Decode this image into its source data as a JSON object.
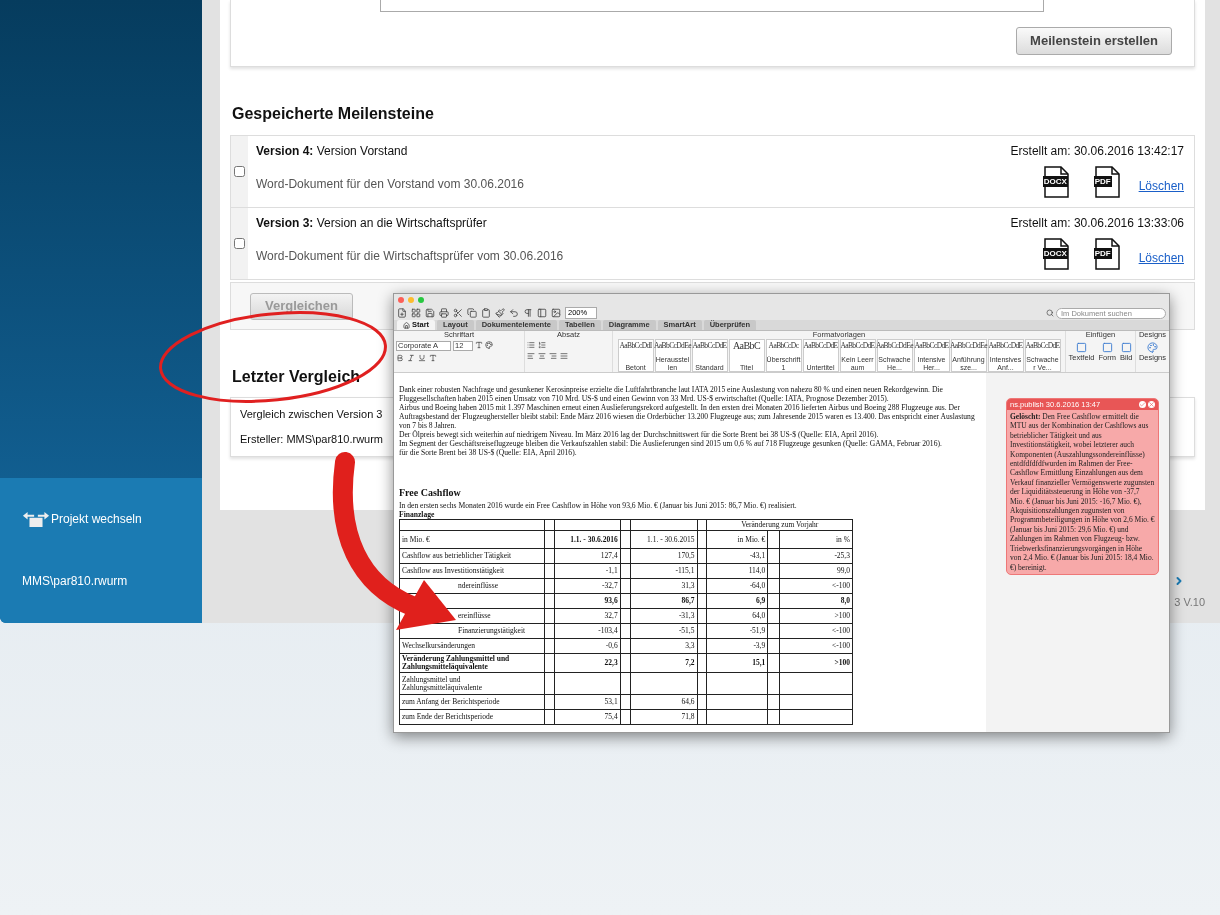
{
  "sidebar": {
    "switch_project": "Projekt wechseln",
    "user": "MMS\\par810.rwurm"
  },
  "milestone_form": {
    "create_button": "Meilenstein erstellen"
  },
  "saved_milestones": {
    "heading": "Gespeicherte Meilensteine",
    "items": [
      {
        "version": "Version 4:",
        "name": "Version Vorstand",
        "description": "Word-Dokument für den Vorstand vom 30.06.2016",
        "created": "Erstellt am: 30.06.2016 13:42:17",
        "checked": false,
        "docx": "DOCX",
        "pdf": "PDF",
        "delete": "Löschen"
      },
      {
        "version": "Version 3:",
        "name": "Version an die Wirtschaftsprüfer",
        "description": "Word-Dokument für die Wirtschaftsprüfer vom 30.06.2016",
        "created": "Erstellt am: 30.06.2016 13:33:06",
        "checked": false,
        "docx": "DOCX",
        "pdf": "PDF",
        "delete": "Löschen"
      }
    ],
    "compare_button": {
      "label": "Vergleichen",
      "disabled": true
    }
  },
  "last_comparison": {
    "heading": "Letzter Vergleich",
    "lines": [
      "Vergleich zwischen Version 3",
      "Ersteller: MMS\\par810.rwurm"
    ]
  },
  "footer": {
    "version": "3 V.10"
  },
  "word_window": {
    "zoom": "200%",
    "search_placeholder": "Im Dokument suchen",
    "tabs": [
      {
        "label": "Start",
        "selected": true
      },
      {
        "label": "Layout",
        "selected": false
      },
      {
        "label": "Dokumentelemente",
        "selected": false
      },
      {
        "label": "Tabellen",
        "selected": false
      },
      {
        "label": "Diagramme",
        "selected": false
      },
      {
        "label": "SmartArt",
        "selected": false
      },
      {
        "label": "Überprüfen",
        "selected": false
      }
    ],
    "groups": {
      "font": "Schriftart",
      "paragraph": "Absatz",
      "styles": "Formatvorlagen",
      "insert": "Einfügen",
      "designs": "Designs"
    },
    "font_name": "Corporate A",
    "font_size": "12",
    "styles": [
      {
        "sample": "AaBbCcDdI",
        "label": "Betont"
      },
      {
        "sample": "AaBbCcDdEe",
        "label": "Herausstellen"
      },
      {
        "sample": "AaBbCcDdE",
        "label": "Standard"
      },
      {
        "sample": "AaBbC",
        "label": "Titel"
      },
      {
        "sample": "AaBbCcDc",
        "label": "Überschrift 1"
      },
      {
        "sample": "AaBbCcDdE",
        "label": "Untertitel"
      },
      {
        "sample": "AaBbCcDdE",
        "label": "Kein Leerraum"
      },
      {
        "sample": "AaBbCcDdEe",
        "label": "Schwache He..."
      },
      {
        "sample": "AaBbCcDdE",
        "label": "Intensive Her..."
      },
      {
        "sample": "AaBbCcDdEe",
        "label": "Anführungsze..."
      },
      {
        "sample": "AaBbCcDdE",
        "label": "Intensives Anf..."
      },
      {
        "sample": "AaBbCcDdE",
        "label": "Schwacher Ve..."
      }
    ],
    "insert": [
      "Textfeld",
      "Form",
      "Bild"
    ],
    "designs_button": "Designs",
    "document": {
      "paragraphs": [
        "Dank einer robusten Nachfrage und gesunkener Kerosinpreise erzielte die Luftfahrtbranche laut IATA 2015 eine Auslastung von nahezu 80 % und einen neuen Rekordgewinn. Die Fluggesellschaften haben 2015 einen Umsatz von 710 Mrd. US-$ und einen Gewinn von 33 Mrd. US-$ erwirtschaftet (Quelle: IATA, Prognose Dezember 2015).",
        "Airbus und Boeing haben 2015 mit 1.397 Maschinen erneut einen Auslieferungsrekord aufgestellt. In den ersten drei Monaten 2016 lieferten Airbus und Boeing 288 Flugzeuge aus. Der Auftragsbestand der Flugzeughersteller bleibt stabil: Ende März 2016 wiesen die Orderbücher 13.200 Flugzeuge aus; zum Jahresende 2015 waren es 13.400. Das entspricht einer Auslastung von 7 bis 8 Jahren.",
        "Der Ölpreis bewegt sich weiterhin auf niedrigem Niveau. Im März 2016 lag der Durchschnittswert für die Sorte Brent bei 38 US-$ (Quelle: EIA, April 2016).",
        "Im Segment der Geschäftsreiseflugzeuge bleiben die Verkaufszahlen stabil: Die Auslieferungen sind 2015 um 0,6 % auf 718 Flugzeuge gesunken (Quelle: GAMA, Februar 2016).",
        "für die Sorte Brent bei 38 US-$ (Quelle: EIA, April 2016)."
      ],
      "heading": "Free Cashflow",
      "intro": "In den ersten sechs Monaten 2016 wurde ein Free Cashflow in Höhe von 93,6 Mio. € (Januar bis Juni 2015: 86,7 Mio. €) realisiert.",
      "table_title": "Finanzlage",
      "table": {
        "group_header": "Veränderung zum Vorjahr",
        "columns": [
          "in Mio. €",
          "1.1. - 30.6.2016",
          "1.1. - 30.6.2015",
          "in Mio. €",
          "in %"
        ],
        "rows": [
          {
            "label": "Cashflow aus betrieblicher Tätigkeit",
            "values": [
              "127,4",
              "170,5",
              "-43,1",
              "-25,3"
            ],
            "bold": false
          },
          {
            "label": "Cashflow aus Investitionstätigkeit",
            "values": [
              "-1,1",
              "-115,1",
              "114,0",
              "99,0"
            ],
            "bold": false
          },
          {
            "label": "ndereinflüsse",
            "values": [
              "-32,7",
              "31,3",
              "-64,0",
              "<-100"
            ],
            "bold": false
          },
          {
            "values": [
              "93,6",
              "86,7",
              "6,9",
              "8,0"
            ],
            "bold": true
          },
          {
            "label": "ereinflüsse",
            "values": [
              "32,7",
              "-31,3",
              "64,0",
              ">100"
            ],
            "bold": false
          },
          {
            "label": "Finanzierungstätigkeit",
            "values": [
              "-103,4",
              "-51,5",
              "-51,9",
              "<-100"
            ],
            "bold": false
          },
          {
            "label": "Wechselkursänderungen",
            "values": [
              "-0,6",
              "3,3",
              "-3,9",
              "<-100"
            ],
            "bold": false
          },
          {
            "label": "Veränderung Zahlungsmittel und Zahlungsmitteläquivalente",
            "values": [
              "22,3",
              "7,2",
              "15,1",
              ">100"
            ],
            "bold": true
          },
          {
            "label": "Zahlungsmittel und Zahlungsmitteläquivalente",
            "bold": false
          },
          {
            "label": "zum Anfang der Berichtsperiode",
            "values": [
              "53,1",
              "64,6"
            ],
            "bold": false
          },
          {
            "label": "zum Ende der Berichtsperiode",
            "values": [
              "75,4",
              "71,8"
            ],
            "bold": false
          }
        ]
      }
    },
    "comment": {
      "header": "ns.publish 30.6.2016 13:47",
      "text": "**Gelöscht:** Den Free Cashflow ermittelt die MTU aus der Kombination der Cashflows aus betrieblicher Tätigkeit und aus Investitionstätigkeit, wobei letzterer auch Komponenten (Auszahlungssondereinflüsse) entdfdfdfdfwurden im Rahmen der Free-Cashflow Ermittlung Einzahlungen aus dem Verkauf finanzieller Vermögenswerte zugunsten der Liquiditätssteuerung in Höhe von -37,7 Mio. € (Januar bis Juni 2015: -16,7 Mio. €), Akquisitionszahlungen zugunsten von Programmbeteiligungen in Höhe von 2,6 Mio. € (Januar bis Juni 2015: 29,6 Mio. €) und Zahlungen im Rahmen von Flugzeug- bzw. Triebwerksfinanzierungsvorgängen in Höhe von 2,4 Mio. € (Januar bis Juni 2015: 18,4 Mio. €) bereinigt."
    }
  }
}
